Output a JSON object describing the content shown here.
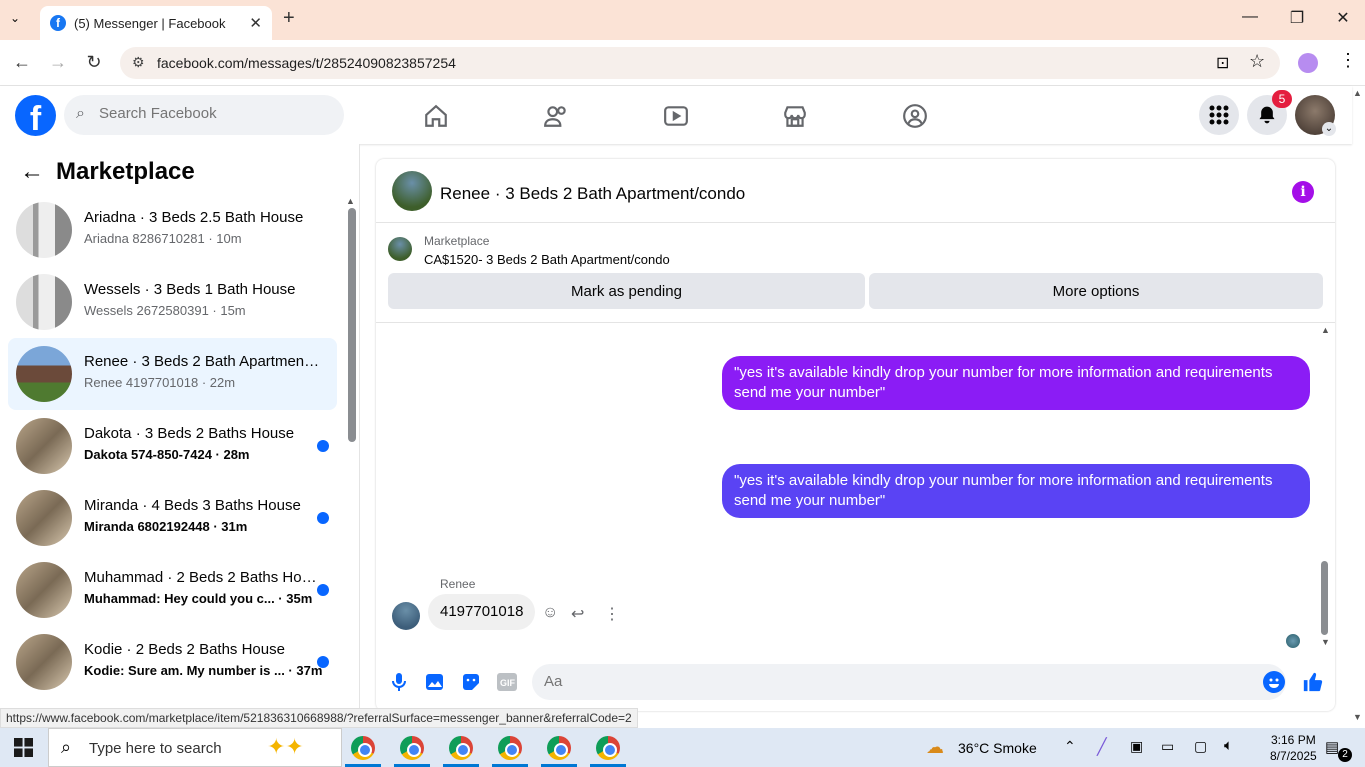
{
  "browser": {
    "tab_title": "(5) Messenger | Facebook",
    "url": "facebook.com/messages/t/28524090823857254",
    "status_url": "https://www.facebook.com/marketplace/item/521836310668988/?referralSurface=messenger_banner&referralCode=2"
  },
  "fb": {
    "search_placeholder": "Search Facebook",
    "notification_count": "5",
    "brand_color": "#0866ff"
  },
  "sidebar": {
    "title": "Marketplace",
    "conversations": [
      {
        "name": "Ariadna · 3 Beds 2.5 Bath House",
        "sub": "Ariadna 8286710281 · 10m",
        "unread": false,
        "selected": false
      },
      {
        "name": "Wessels · 3 Beds 1 Bath House",
        "sub": "Wessels 2672580391 · 15m",
        "unread": false,
        "selected": false
      },
      {
        "name": "Renee · 3 Beds 2 Bath Apartment/condo",
        "sub": "Renee 4197701018 · 22m",
        "unread": false,
        "selected": true
      },
      {
        "name": "Dakota · 3 Beds 2 Baths House",
        "sub": "Dakota 574-850-7424 · 28m",
        "unread": true,
        "selected": false
      },
      {
        "name": "Miranda · 4 Beds 3 Baths House",
        "sub": "Miranda 6802192448 · 31m",
        "unread": true,
        "selected": false
      },
      {
        "name": "Muhammad · 2 Beds 2 Baths House",
        "sub": "Muhammad: Hey could you c... · 35m",
        "unread": true,
        "selected": false
      },
      {
        "name": "Kodie · 2 Beds 2 Baths House",
        "sub": "Kodie: Sure am. My number is ... · 37m",
        "unread": true,
        "selected": false
      }
    ]
  },
  "chat": {
    "title": "Renee · 3 Beds 2 Bath Apartment/condo",
    "banner_label": "Marketplace",
    "listing": "CA$1520- 3 Beds 2 Bath Apartment/condo",
    "mark_pending": "Mark as pending",
    "more_options": "More options",
    "messages_out": [
      "\"yes it's available kindly drop your number for more information and requirements send me your number\"",
      "\"yes it's available kindly drop your number for more information and requirements send me your number\""
    ],
    "incoming_sender": "Renee",
    "incoming_text": "4197701018",
    "composer_placeholder": "Aa"
  },
  "taskbar": {
    "search_placeholder": "Type here to search",
    "weather": "36°C  Smoke",
    "time": "3:16 PM",
    "date": "8/7/2025",
    "notif_count": "2"
  }
}
